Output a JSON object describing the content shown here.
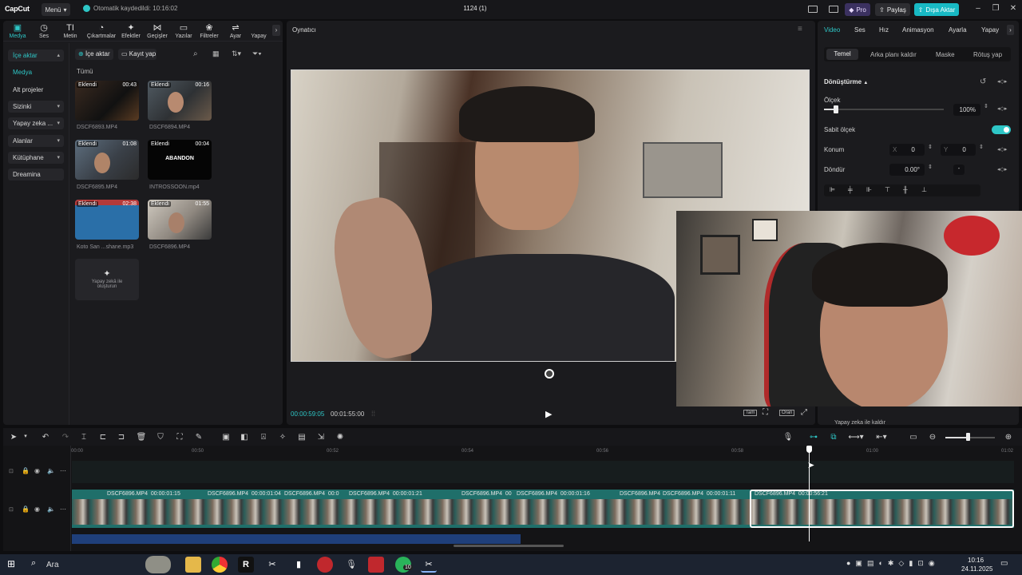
{
  "titlebar": {
    "logo": "CapCut",
    "menu_label": "Menü",
    "autosave_text": "Otomatik kaydedildi: 10:16:02",
    "project_title": "1124 (1)",
    "pro_label": "Pro",
    "share_label": "Paylaş",
    "export_label": "Dışa Aktar"
  },
  "toolbar": {
    "items": [
      "Medya",
      "Ses",
      "Metin",
      "Çıkartmalar",
      "Efektler",
      "Geçişler",
      "Yazılar",
      "Filtreler",
      "Ayar",
      "Yapay"
    ]
  },
  "sidebar": {
    "items": [
      "İçe aktar",
      "Medya",
      "Alt projeler",
      "Sizinki",
      "Yapay zeka ...",
      "Alanlar",
      "Kütüphane",
      "Dreamina"
    ]
  },
  "media": {
    "import_label": "İçe aktar",
    "record_label": "Kayıt yap",
    "filter_all": "Tümü",
    "added_badge": "Eklendi",
    "items": [
      {
        "name": "DSCF6893.MP4",
        "duration": "00:43"
      },
      {
        "name": "DSCF6894.MP4",
        "duration": "00:16"
      },
      {
        "name": "DSCF6895.MP4",
        "duration": "01:08"
      },
      {
        "name": "INTROSSOON.mp4",
        "duration": "00:04",
        "overlay": "ABANDON"
      },
      {
        "name": "Koto San ...shane.mp3",
        "duration": "02:38"
      },
      {
        "name": "DSCF6896.MP4",
        "duration": "01:55"
      }
    ],
    "ai_card_label": "Yapay zekâ ile oluşturun"
  },
  "player": {
    "title": "Oynatıcı",
    "current_time": "00:00:59:05",
    "total_time": "00:01:55:00",
    "full_label": "Tam",
    "ratio_label": "Oran"
  },
  "inspector": {
    "tabs": [
      "Video",
      "Ses",
      "Hız",
      "Animasyon",
      "Ayarla",
      "Yapay"
    ],
    "subtabs": [
      "Temel",
      "Arka planı kaldır",
      "Maske",
      "Rötuş yap"
    ],
    "section_transform": "Dönüştürme",
    "scale_label": "Ölçek",
    "scale_value": "100%",
    "scale_fraction": 0.1,
    "uniform_scale_label": "Sabit ölçek",
    "position_label": "Konum",
    "pos_x_label": "X",
    "pos_x": "0",
    "pos_y_label": "Y",
    "pos_y": "0",
    "rotate_label": "Döndür",
    "rotate_value": "0.00°",
    "ai_remove_label": "Yapay zeka ile kaldır"
  },
  "timeline": {
    "ruler_ticks": [
      "00:00",
      "00:50",
      "00:52",
      "00:54",
      "00:56",
      "00:58",
      "01:00",
      "01:02"
    ],
    "clips": [
      {
        "name": "DSCF6896.MP4",
        "duration": "00:00:01:15"
      },
      {
        "name": "DSCF6896.MP4",
        "duration": "00:00:01:04"
      },
      {
        "name": "DSCF6896.MP4",
        "duration": "00:0"
      },
      {
        "name": "DSCF6896.MP4",
        "duration": "00:00:01:21"
      },
      {
        "name": "DSCF6896.MP4",
        "duration": "00"
      },
      {
        "name": "DSCF6896.MP4",
        "duration": "00:00:01:16"
      },
      {
        "name": "DSCF6896.MP4",
        "duration": ""
      },
      {
        "name": "DSCF6896.MP4",
        "duration": "00:00:01:11"
      },
      {
        "name": "DSCF6896.MP4",
        "duration": "00:00:56:21"
      }
    ]
  },
  "taskbar": {
    "search_label": "Ara",
    "time": "10:16",
    "date": "24.11.2025",
    "whatsapp_badge": "10"
  },
  "colors": {
    "accent": "#2ec6c6",
    "export_bg": "#18b9c4",
    "pro_bg": "#4a3a7a",
    "clip_teal": "#1f6f6a",
    "audio_blue": "#1f3f7a"
  }
}
